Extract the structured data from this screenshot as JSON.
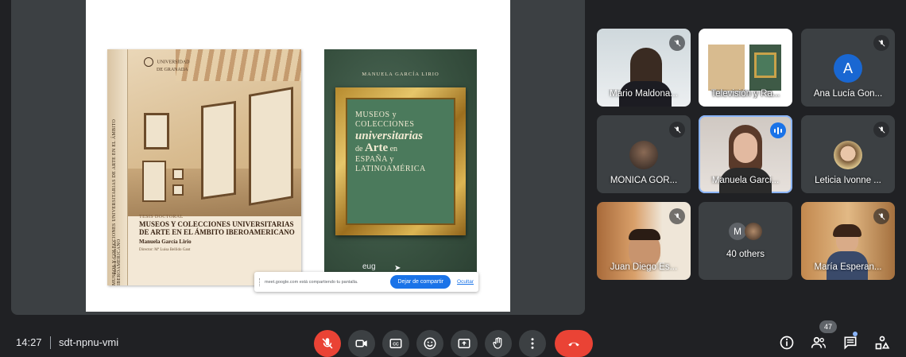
{
  "presentation": {
    "book1": {
      "spine_title": "MUSEOS Y COLECCIONES UNIVERSITARIAS DE ARTE EN EL ÁMBITO IBEROAMERICANO",
      "spine_author": "Manuela García Lirio",
      "university_line1": "UNIVERSIDAD",
      "university_line2": "DE GRANADA",
      "tag": "TESIS DOCTORAL",
      "title": "MUSEOS Y COLECCIONES UNIVERSITARIAS DE ARTE EN EL ÁMBITO IBEROAMERICANO",
      "author": "Manuela García Lirio",
      "director": "Director: Mª Luisa Bellido Gant"
    },
    "book2": {
      "author": "MANUELA GARCÍA LIRIO",
      "line1": "MUSEOS y",
      "line2": "COLECCIONES",
      "line3": "universitarias",
      "line4_prefix": "de",
      "line4_big": "Arte",
      "line4_suffix": "en",
      "line5": "ESPAÑA y",
      "line6": "LATINOAMÉRICA",
      "publisher": "eug"
    },
    "sharebar": {
      "message": "meet.google.com está compartiendo tu pantalla.",
      "stop_label": "Dejar de compartir",
      "hide_label": "Ocultar"
    }
  },
  "participants": [
    {
      "name": "Mario Maldona...",
      "muted": true
    },
    {
      "name": "Televisión y Ra...",
      "muted": false
    },
    {
      "name": "Ana Lucía Gon...",
      "muted": true,
      "initial": "A",
      "color": "#1967d2"
    },
    {
      "name": "MONICA GOR...",
      "muted": true
    },
    {
      "name": "Manuela Garci...",
      "muted": false,
      "speaking": true
    },
    {
      "name": "Leticia Ivonne ...",
      "muted": true
    },
    {
      "name": "Juan Diego Es...",
      "muted": true
    },
    {
      "name": "40 others",
      "initial": "M",
      "color": "#5f6368"
    },
    {
      "name": "María Esperan...",
      "muted": true
    }
  ],
  "bottom_bar": {
    "time": "14:27",
    "meeting_code": "sdt-npnu-vmi",
    "participant_count": "47",
    "controls": [
      "mic-off-icon",
      "camera-icon",
      "captions-icon",
      "emoji-icon",
      "present-icon",
      "raise-hand-icon",
      "more-icon",
      "hang-up-icon"
    ],
    "right": [
      "info-icon",
      "people-icon",
      "chat-icon",
      "activities-icon"
    ]
  },
  "colors": {
    "background": "#202124",
    "accent": "#1a73e8",
    "danger": "#ea4335",
    "tile": "#3c4043"
  }
}
